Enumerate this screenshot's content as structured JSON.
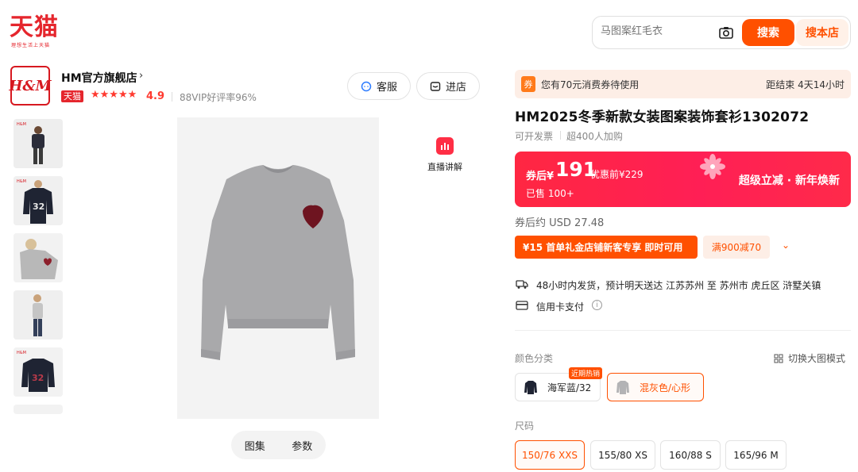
{
  "brand": {
    "logo": "天猫",
    "tagline": "理想生活上天猫"
  },
  "search": {
    "placeholder": "马图案红毛衣",
    "search_label": "搜索",
    "store_search_label": "搜本店"
  },
  "store": {
    "logo_text": "H&M",
    "name": "HM官方旗舰店",
    "chevron": "›",
    "badge": "天猫",
    "stars": "★★★★★",
    "rating": "4.9",
    "vip_rate": "88VIP好评率96%",
    "service_label": "客服",
    "enter_label": "进店"
  },
  "gallery": {
    "thumbnails": [
      "thumb-1",
      "thumb-2",
      "thumb-3",
      "thumb-4",
      "thumb-5"
    ],
    "live_label": "直播讲解",
    "tab_gallery": "图集",
    "tab_params": "参数"
  },
  "coupon_banner": {
    "icon": "券",
    "text": "您有70元消费券待使用",
    "countdown": "距结束 4天14小时"
  },
  "product": {
    "title": "HM2025冬季新款女装图案装饰套衫1302072",
    "invoice": "可开发票",
    "cart_count": "超400人加购"
  },
  "price": {
    "label": "券后¥",
    "value": "191",
    "original": "优惠前¥229",
    "sold": "已售 100+",
    "slogan": "超级立减 · 新年焕新",
    "usd": "券后约 USD 27.48"
  },
  "promotions": {
    "new_customer": "¥15  首单礼金店铺新客专享 即时可用",
    "discount": "满900减70",
    "more_chevron": "⌄"
  },
  "delivery": {
    "shipping": "48小时内发货，预计明天送达  江苏苏州 至 苏州市 虎丘区 浒墅关镇",
    "payment": "信用卡支付",
    "info_icon": "i"
  },
  "colors": {
    "label": "颜色分类",
    "switch_view": "切换大图模式",
    "options": [
      {
        "name": "海军蓝/32",
        "tag": "近期热销",
        "selected": false
      },
      {
        "name": "混灰色/心形",
        "selected": true
      }
    ]
  },
  "sizes": {
    "label": "尺码",
    "options": [
      "150/76 XXS",
      "155/80 XS",
      "160/88 S",
      "165/96 M"
    ],
    "selected": "150/76 XXS"
  },
  "theme": {
    "accent": "#ff5000",
    "tmall_red": "#e5262d",
    "price_red": "#ff2742"
  }
}
